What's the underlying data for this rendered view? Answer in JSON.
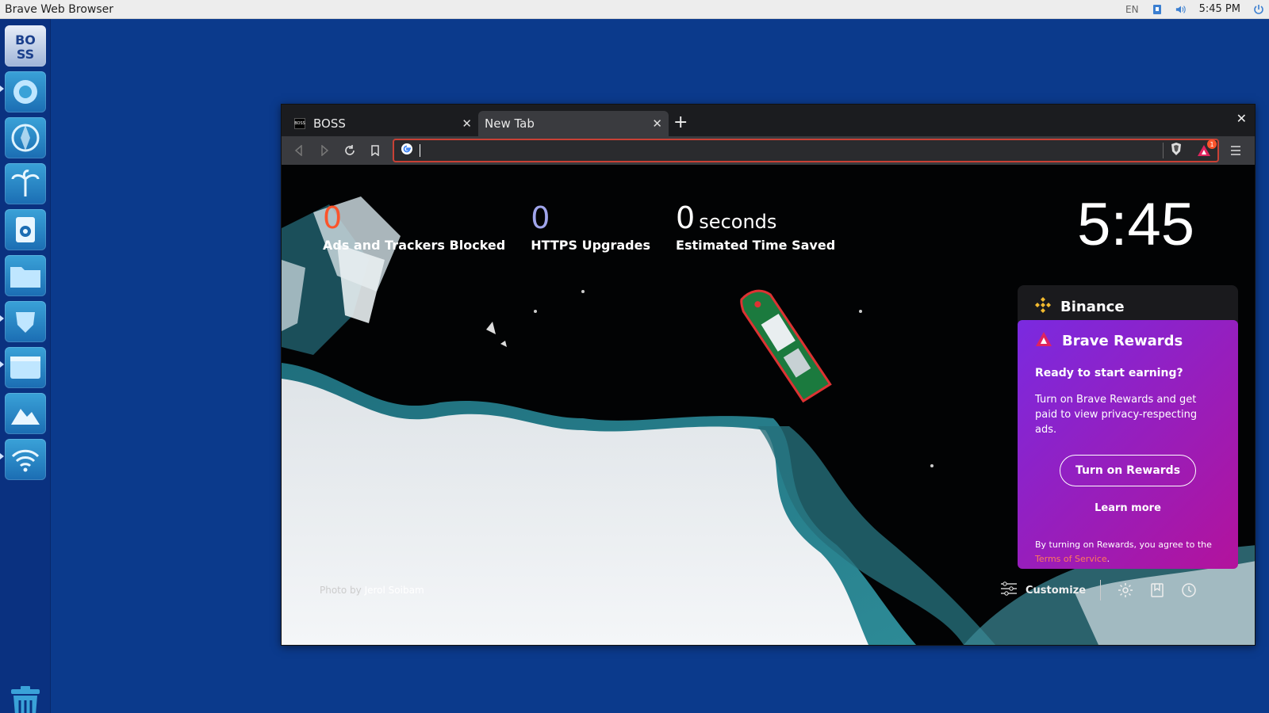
{
  "top_panel": {
    "app_title": "Brave Web Browser",
    "lang": "EN",
    "time": "5:45 PM"
  },
  "dock": {
    "items": [
      {
        "name": "boss-logo-icon"
      },
      {
        "name": "settings-gear-icon"
      },
      {
        "name": "aperture-icon"
      },
      {
        "name": "palm-tree-icon"
      },
      {
        "name": "speaker-icon"
      },
      {
        "name": "folder-icon"
      },
      {
        "name": "brave-lion-icon"
      },
      {
        "name": "terminal-icon"
      },
      {
        "name": "mountain-icon"
      },
      {
        "name": "wifi-icon"
      }
    ]
  },
  "browser": {
    "tabs": [
      {
        "title": "BOSS",
        "active": false
      },
      {
        "title": "New Tab",
        "active": true
      }
    ],
    "address": {
      "value": "",
      "placeholder": ""
    },
    "rewards_badge": "1"
  },
  "ntp": {
    "stats": [
      {
        "value": "0",
        "unit": "",
        "label": "Ads and Trackers Blocked",
        "color": "#fb542b"
      },
      {
        "value": "0",
        "unit": "",
        "label": "HTTPS Upgrades",
        "color": "#a0a5eb"
      },
      {
        "value": "0",
        "unit": "seconds",
        "label": "Estimated Time Saved",
        "color": "#ffffff"
      }
    ],
    "clock": "5:45",
    "binance_title": "Binance",
    "rewards": {
      "title": "Brave Rewards",
      "subtitle": "Ready to start earning?",
      "description": "Turn on Brave Rewards and get paid to view privacy-respecting ads.",
      "button": "Turn on Rewards",
      "learn_more": "Learn more",
      "tos_prefix": "By turning on Rewards, you agree to the",
      "tos_link": "Terms of Service",
      "tos_suffix": "."
    },
    "photo_credit_prefix": "Photo by",
    "photo_credit_author": "Jerol Soibam",
    "customize": "Customize"
  },
  "colors": {
    "desktop": "#0b3a8c",
    "accent_red": "#fb542b",
    "rewards_purple": "#7a2ae0",
    "rewards_magenta": "#b3129c"
  }
}
